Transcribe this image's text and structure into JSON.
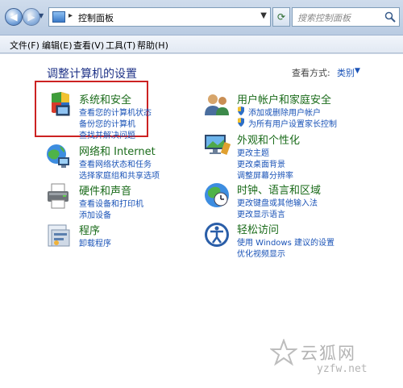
{
  "titlebar": {
    "address_path": "控制面板",
    "search_placeholder": "搜索控制面板"
  },
  "menubar": {
    "items": [
      "文件(F)",
      "编辑(E)",
      "查看(V)",
      "工具(T)",
      "帮助(H)"
    ]
  },
  "main": {
    "heading": "调整计算机的设置",
    "view_label": "查看方式:",
    "view_value": "类别"
  },
  "categories": [
    {
      "title": "系统和安全",
      "links": [
        "查看您的计算机状态",
        "备份您的计算机",
        "查找并解决问题"
      ],
      "icon": "shield-computer-icon"
    },
    {
      "title": "网络和 Internet",
      "links": [
        "查看网络状态和任务",
        "选择家庭组和共享选项"
      ],
      "icon": "network-globe-icon"
    },
    {
      "title": "硬件和声音",
      "links": [
        "查看设备和打印机",
        "添加设备"
      ],
      "icon": "printer-icon"
    },
    {
      "title": "程序",
      "links": [
        "卸载程序"
      ],
      "icon": "programs-icon"
    },
    {
      "title": "用户帐户和家庭安全",
      "links": [
        "添加或删除用户帐户",
        "为所有用户设置家长控制"
      ],
      "icon": "users-icon"
    },
    {
      "title": "外观和个性化",
      "links": [
        "更改主题",
        "更改桌面背景",
        "调整屏幕分辨率"
      ],
      "icon": "monitor-icon"
    },
    {
      "title": "时钟、语言和区域",
      "links": [
        "更改键盘或其他输入法",
        "更改显示语言"
      ],
      "icon": "clock-globe-icon"
    },
    {
      "title": "轻松访问",
      "links": [
        "使用 Windows 建议的设置",
        "优化视频显示"
      ],
      "icon": "accessibility-icon"
    }
  ],
  "watermark": {
    "text": "云狐网",
    "sub": "yzfw.net"
  }
}
